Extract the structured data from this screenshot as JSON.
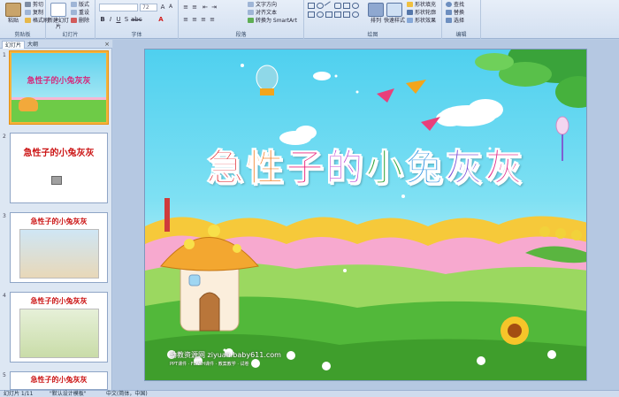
{
  "ribbon": {
    "clipboard": {
      "paste": "粘贴",
      "cut": "剪切",
      "copy": "复制",
      "format_painter": "格式刷",
      "label": "剪贴板"
    },
    "slides": {
      "new_slide": "新建幻灯片",
      "layout": "版式",
      "reset": "重设",
      "delete": "删除",
      "label": "幻灯片"
    },
    "font": {
      "font_size": "72",
      "label": "字体"
    },
    "paragraph": {
      "text_direction": "文字方向",
      "align_text": "对齐文本",
      "smartart": "转换为 SmartArt",
      "label": "段落"
    },
    "drawing": {
      "arrange": "排列",
      "quick_styles": "快速样式",
      "shape_fill": "形状填充",
      "shape_outline": "形状轮廓",
      "shape_effects": "形状效果",
      "label": "绘图"
    },
    "editing": {
      "find": "查找",
      "replace": "替换",
      "select": "选择",
      "label": "编辑"
    }
  },
  "left_panel": {
    "tabs": [
      "幻灯片",
      "大纲"
    ],
    "close": "×",
    "thumbnails": [
      {
        "number": "1",
        "title": "急性子的小兔灰灰"
      },
      {
        "number": "2",
        "title": "急性子的小兔灰灰"
      },
      {
        "number": "3",
        "title": "急性子的小兔灰灰"
      },
      {
        "number": "4",
        "title": "急性子的小兔灰灰"
      },
      {
        "number": "5",
        "title": "急性子的小兔灰灰"
      }
    ]
  },
  "slide": {
    "title_chars": [
      "急",
      "性",
      "子",
      "的",
      "小",
      "兔",
      "灰",
      "灰"
    ],
    "title_colors": [
      "#e0262e",
      "#f07a1c",
      "#e7207a",
      "#b83bd0",
      "#2fa43a",
      "#2a8fe0",
      "#7b4fd6",
      "#df2d8c"
    ],
    "watermark": "幼教资源网 ziyuan.baby611.com",
    "watermark_sub": "PPT课件 · FLASH课件 · 教案教学 · 试卷"
  },
  "status_bar": {
    "slide_count": "幻灯片 1/11",
    "theme": "\"默认设计模板\"",
    "language": "中文(简体，中国)"
  },
  "colors": {
    "ribbon_bg": "#dce6f4",
    "selected_thumb": "#f5b33a",
    "title_red": "#cc1616"
  }
}
